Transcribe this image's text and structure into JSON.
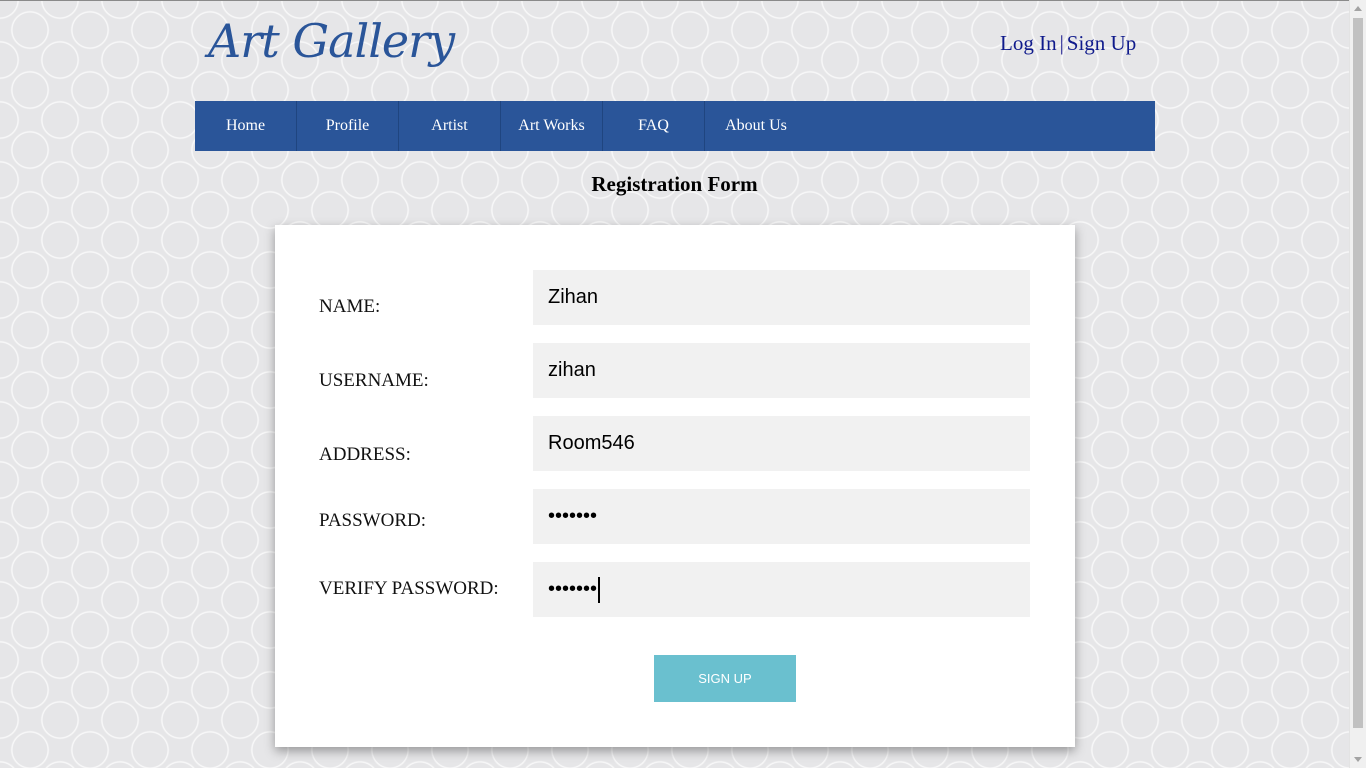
{
  "header": {
    "logo": "Art Gallery",
    "login_link": "Log In",
    "separator": "|",
    "signup_link": "Sign Up"
  },
  "nav": {
    "items": [
      {
        "label": "Home"
      },
      {
        "label": "Profile"
      },
      {
        "label": "Artist"
      },
      {
        "label": "Art Works"
      },
      {
        "label": "FAQ"
      },
      {
        "label": "About Us"
      }
    ]
  },
  "form": {
    "title": "Registration Form",
    "fields": [
      {
        "label": "NAME:",
        "value": "Zihan"
      },
      {
        "label": "USERNAME:",
        "value": "zihan"
      },
      {
        "label": "ADDRESS:",
        "value": "Room546"
      },
      {
        "label": "PASSWORD:",
        "value": "•••••••"
      },
      {
        "label": "VERIFY PASSWORD:",
        "value": "•••••••"
      }
    ],
    "submit_label": "SIGN UP"
  },
  "colors": {
    "brand": "#2a5599",
    "button": "#6ac0cf",
    "field_bg": "#f1f1f1"
  }
}
